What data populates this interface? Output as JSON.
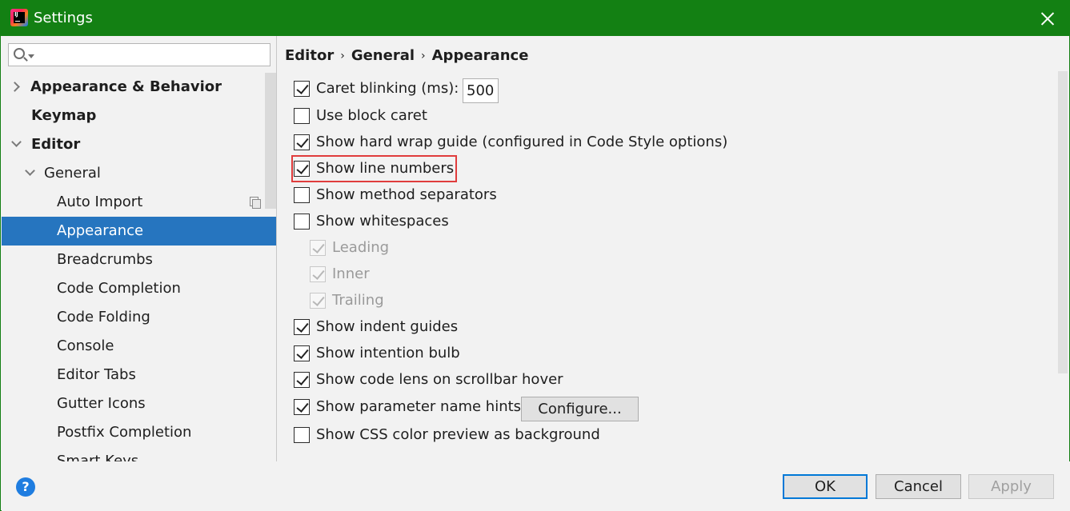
{
  "window": {
    "title": "Settings"
  },
  "search": {
    "value": "",
    "placeholder": ""
  },
  "tree": {
    "items": [
      {
        "label": "Appearance & Behavior"
      },
      {
        "label": "Keymap"
      },
      {
        "label": "Editor"
      },
      {
        "label": "General"
      },
      {
        "label": "Auto Import"
      },
      {
        "label": "Appearance"
      },
      {
        "label": "Breadcrumbs"
      },
      {
        "label": "Code Completion"
      },
      {
        "label": "Code Folding"
      },
      {
        "label": "Console"
      },
      {
        "label": "Editor Tabs"
      },
      {
        "label": "Gutter Icons"
      },
      {
        "label": "Postfix Completion"
      },
      {
        "label": "Smart Keys"
      }
    ],
    "selected": "Appearance"
  },
  "breadcrumb": {
    "parts": [
      "Editor",
      "General",
      "Appearance"
    ],
    "separator": "›"
  },
  "options": [
    {
      "label": "Caret blinking (ms):",
      "checked": true
    },
    {
      "label": "Use block caret",
      "checked": false
    },
    {
      "label": "Show hard wrap guide (configured in Code Style options)",
      "checked": true
    },
    {
      "label": "Show line numbers",
      "checked": true,
      "highlighted": true
    },
    {
      "label": "Show method separators",
      "checked": false
    },
    {
      "label": "Show whitespaces",
      "checked": false
    },
    {
      "label": "Leading",
      "checked": true,
      "disabled": true
    },
    {
      "label": "Inner",
      "checked": true,
      "disabled": true
    },
    {
      "label": "Trailing",
      "checked": true,
      "disabled": true
    },
    {
      "label": "Show indent guides",
      "checked": true
    },
    {
      "label": "Show intention bulb",
      "checked": true
    },
    {
      "label": "Show code lens on scrollbar hover",
      "checked": true
    },
    {
      "label": "Show parameter name hints",
      "checked": true
    },
    {
      "label": "Show CSS color preview as background",
      "checked": false
    }
  ],
  "caret_blink_ms": "500",
  "configure_button": "Configure...",
  "footer": {
    "help": "?",
    "ok": "OK",
    "cancel": "Cancel",
    "apply": "Apply"
  },
  "colors": {
    "titlebar": "#138013",
    "selection": "#2675bf",
    "highlight": "#e03c3c"
  }
}
